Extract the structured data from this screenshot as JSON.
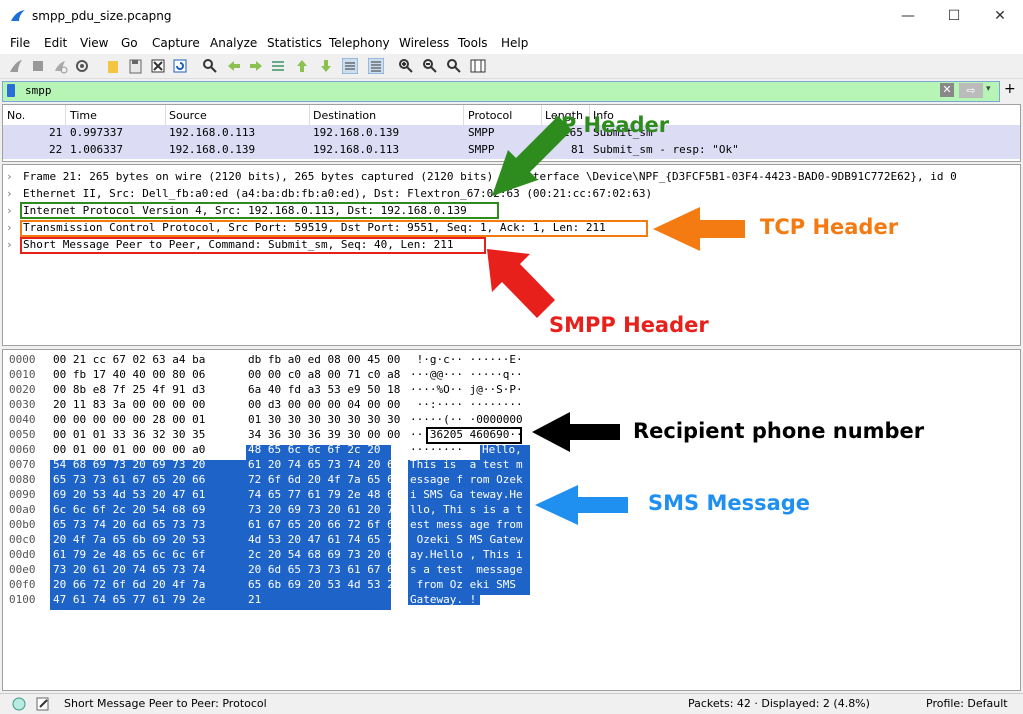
{
  "window": {
    "title": "smpp_pdu_size.pcapng",
    "minimize": "—",
    "maximize": "☐",
    "close": "✕"
  },
  "menu": [
    "File",
    "Edit",
    "View",
    "Go",
    "Capture",
    "Analyze",
    "Statistics",
    "Telephony",
    "Wireless",
    "Tools",
    "Help"
  ],
  "toolbar_icons": [
    "shark-fin-start-icon",
    "stop-icon",
    "restart-icon",
    "options-icon",
    "open-file-icon",
    "save-file-icon",
    "close-file-icon",
    "reload-icon",
    "find-icon",
    "back-icon",
    "forward-icon",
    "go-to-packet-icon",
    "first-packet-icon",
    "last-packet-icon",
    "autoscroll-icon",
    "colorize-icon",
    "zoom-in-icon",
    "zoom-out-icon",
    "normal-size-icon",
    "resize-columns-icon"
  ],
  "filter": {
    "value": "smpp",
    "clear": "✕",
    "apply": "⇨",
    "dropdown": "▾",
    "add": "+"
  },
  "packet_list": {
    "headers": [
      "No.",
      "Time",
      "Source",
      "Destination",
      "Protocol",
      "Length",
      "Info"
    ],
    "rows": [
      {
        "no": "21",
        "time": "0.997337",
        "src": "192.168.0.113",
        "dst": "192.168.0.139",
        "proto": "SMPP",
        "len": "265",
        "info": "Submit_sm"
      },
      {
        "no": "22",
        "time": "1.006337",
        "src": "192.168.0.139",
        "dst": "192.168.0.113",
        "proto": "SMPP",
        "len": "81",
        "info": "Submit_sm - resp: \"Ok\""
      }
    ]
  },
  "details": [
    "Frame 21: 265 bytes on wire (2120 bits), 265 bytes captured (2120 bits) on interface \\Device\\NPF_{D3FCF5B1-03F4-4423-BAD0-9DB91C772E62}, id 0",
    "Ethernet II, Src: Dell_fb:a0:ed (a4:ba:db:fb:a0:ed), Dst: Flextron_67:02:63 (00:21:cc:67:02:63)",
    "Internet Protocol Version 4, Src: 192.168.0.113, Dst: 192.168.0.139",
    "Transmission Control Protocol, Src Port: 59519, Dst Port: 9551, Seq: 1, Ack: 1, Len: 211",
    "Short Message Peer to Peer, Command: Submit_sm, Seq: 40, Len: 211"
  ],
  "bytes": [
    {
      "off": "0000",
      "hex1": "00 21 cc 67 02 63 a4 ba",
      "hex2": "db fb a0 ed 08 00 45 00",
      "ascii": " !·g·c·· ······E·"
    },
    {
      "off": "0010",
      "hex1": "00 fb 17 40 40 00 80 06",
      "hex2": "00 00 c0 a8 00 71 c0 a8",
      "ascii": "···@@··· ·····q··"
    },
    {
      "off": "0020",
      "hex1": "00 8b e8 7f 25 4f 91 d3",
      "hex2": "6a 40 fd a3 53 e9 50 18",
      "ascii": "····%O·· j@··S·P·"
    },
    {
      "off": "0030",
      "hex1": "20 11 83 3a 00 00 00 00",
      "hex2": "00 d3 00 00 00 04 00 00",
      "ascii": " ··:···· ········"
    },
    {
      "off": "0040",
      "hex1": "00 00 00 00 00 28 00 01",
      "hex2": "01 30 30 30 30 30 30 30",
      "ascii": "·····(·· ·0000000"
    },
    {
      "off": "0050",
      "hex1": "00 01 01 33 36 32 30 35",
      "hex2": "34 36 30 36 39 30 00 00",
      "ascii": "···36205 460690··"
    },
    {
      "off": "0060",
      "hex1": "00 01 00 01 00 00 00 a0",
      "hex2": "48 65 6c 6c 6f 2c 20",
      "hex2b": "",
      "ascii": "········",
      "ascii_sel": "Hello, "
    },
    {
      "off": "0070",
      "hex1": "54 68 69 73 20 69 73 20",
      "hex2": "61 20 74 65 73 74 20 6d",
      "ascii": "This is  a test m"
    },
    {
      "off": "0080",
      "hex1": "65 73 73 61 67 65 20 66",
      "hex2": "72 6f 6d 20 4f 7a 65 6b",
      "ascii": "essage f rom Ozek"
    },
    {
      "off": "0090",
      "hex1": "69 20 53 4d 53 20 47 61",
      "hex2": "74 65 77 61 79 2e 48 65",
      "ascii": "i SMS Ga teway.He"
    },
    {
      "off": "00a0",
      "hex1": "6c 6c 6f 2c 20 54 68 69",
      "hex2": "73 20 69 73 20 61 20 74",
      "ascii": "llo, Thi s is a t"
    },
    {
      "off": "00b0",
      "hex1": "65 73 74 20 6d 65 73 73",
      "hex2": "61 67 65 20 66 72 6f 6d",
      "ascii": "est mess age from"
    },
    {
      "off": "00c0",
      "hex1": "20 4f 7a 65 6b 69 20 53",
      "hex2": "4d 53 20 47 61 74 65 77",
      "ascii": " Ozeki S MS Gatew"
    },
    {
      "off": "00d0",
      "hex1": "61 79 2e 48 65 6c 6c 6f",
      "hex2": "2c 20 54 68 69 73 20 69",
      "ascii": "ay.Hello , This i"
    },
    {
      "off": "00e0",
      "hex1": "73 20 61 20 74 65 73 74",
      "hex2": "20 6d 65 73 73 61 67 65",
      "ascii": "s a test  message"
    },
    {
      "off": "00f0",
      "hex1": "20 66 72 6f 6d 20 4f 7a",
      "hex2": "65 6b 69 20 53 4d 53 20",
      "ascii": " from Oz eki SMS "
    },
    {
      "off": "0100",
      "hex1": "47 61 74 65 77 61 79 2e",
      "hex2": "21",
      "ascii": "Gateway. !"
    }
  ],
  "annotations": {
    "ip": {
      "label": "IP Header",
      "color": "#2e8b1e"
    },
    "tcp": {
      "label": "TCP Header",
      "color": "#f47a12"
    },
    "smpp": {
      "label": "SMPP Header",
      "color": "#e8201c"
    },
    "phone": {
      "label": "Recipient phone number",
      "color": "#000000"
    },
    "sms": {
      "label": "SMS Message",
      "color": "#1f8ff0"
    }
  },
  "status": {
    "left": "Short Message Peer to Peer: Protocol",
    "packets": "Packets: 42 · Displayed: 2 (4.8%)",
    "profile": "Profile: Default"
  }
}
